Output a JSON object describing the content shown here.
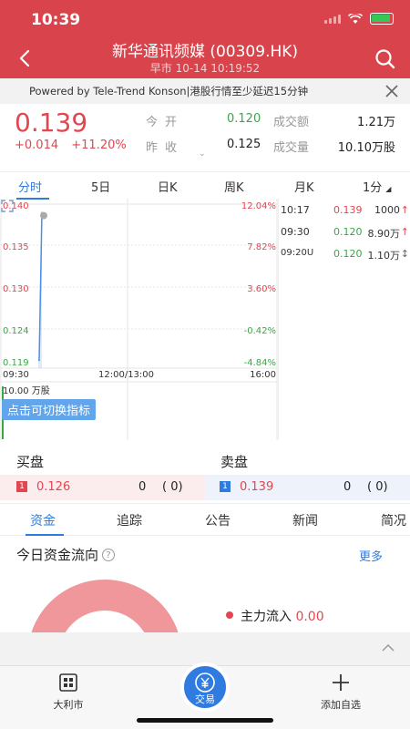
{
  "status_bar": {
    "time": "10:39"
  },
  "header": {
    "title": "新华通讯频媒 (00309.HK)",
    "subtitle": "早市 10-14 10:19:52"
  },
  "powered_bar": {
    "text": "Powered by Tele-Trend Konson|港股行情至少延迟15分钟"
  },
  "quote": {
    "price": "0.139",
    "change": "+0.014",
    "change_pct": "+11.20%",
    "open_label": "今开",
    "open_value": "0.120",
    "prev_close_label": "昨收",
    "prev_close_value": "0.125",
    "turnover_label": "成交额",
    "turnover_value": "1.21万",
    "volume_label": "成交量",
    "volume_value": "10.10万股"
  },
  "chart_tabs": [
    {
      "label": "分时"
    },
    {
      "label": "5日"
    },
    {
      "label": "日K"
    },
    {
      "label": "周K"
    },
    {
      "label": "月K"
    },
    {
      "label": "1分"
    }
  ],
  "chart": {
    "left_ticks": [
      "0.140",
      "0.135",
      "0.130",
      "0.124",
      "0.119"
    ],
    "right_ticks": [
      "12.04%",
      "7.82%",
      "3.60%",
      "-0.42%",
      "-4.84%"
    ],
    "time_ticks": [
      "09:30",
      "12:00/13:00",
      "16:00"
    ],
    "volume_label": "10.00 万股",
    "tip": "点击可切换指标"
  },
  "chart_data": {
    "type": "line",
    "x_range": [
      "09:30",
      "16:00"
    ],
    "ylim": [
      0.119,
      0.14
    ],
    "series": [
      {
        "x": [
          "09:30",
          "09:30",
          "09:31"
        ],
        "values": [
          0.12,
          0.12,
          0.139
        ]
      }
    ]
  },
  "trades": [
    {
      "time": "10:17",
      "price": "0.139",
      "qty": "1000",
      "arrow": "↑",
      "price_color": "#e0474f"
    },
    {
      "time": "09:30",
      "price": "0.120",
      "qty": "8.90万",
      "arrow": "↑",
      "price_color": "#3aa845"
    },
    {
      "time": "09:20U",
      "price": "0.120",
      "qty": "1.10万",
      "arrow": "↕",
      "price_color": "#3aa845"
    }
  ],
  "order_book": {
    "bid_title": "买盘",
    "ask_title": "卖盘",
    "bid": {
      "level": "1",
      "price": "0.126",
      "qty": "0",
      "orders": "( 0)"
    },
    "ask": {
      "level": "1",
      "price": "0.139",
      "qty": "0",
      "orders": "( 0)"
    }
  },
  "section_tabs": [
    {
      "label": "资金"
    },
    {
      "label": "追踪"
    },
    {
      "label": "公告"
    },
    {
      "label": "新闻"
    },
    {
      "label": "简况"
    }
  ],
  "capital_flow": {
    "title": "今日资金流向",
    "help_icon_text": "?",
    "more": "更多",
    "legend_label": "主力流入",
    "legend_value": "0.00"
  },
  "bottom_nav": {
    "left_label": "大利市",
    "center_label": "交易",
    "right_label": "添加自选"
  },
  "colors": {
    "header": "#d9434b",
    "up": "#e0474f",
    "down": "#3aa845",
    "accent": "#2f7be0"
  }
}
